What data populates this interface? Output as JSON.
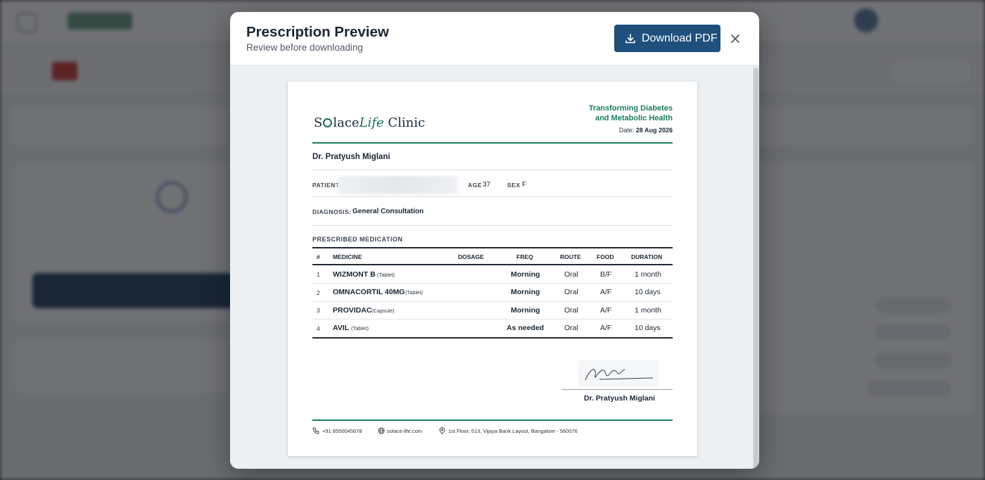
{
  "modal": {
    "title": "Prescription Preview",
    "subtitle": "Review before downloading",
    "download_label": "Download PDF"
  },
  "prescription": {
    "clinic_name": {
      "prefix": "S",
      "mid": "lace",
      "life": "Life",
      "rest": " Clinic"
    },
    "tagline_line1": "Transforming Diabetes",
    "tagline_line2": "and Metabolic Health",
    "date_label": "Date:",
    "date_value": "28 Aug 2026",
    "doctor_name": "Dr. Pratyush Miglani",
    "patient_label": "PATIENT",
    "age_label": "AGE",
    "age_value": "37",
    "sex_label": "SEX",
    "sex_value": "F",
    "diagnosis_label": "DIAGNOSIS:",
    "diagnosis_value": "General Consultation",
    "section_title": "PRESCRIBED MEDICATION",
    "columns": [
      "#",
      "MEDICINE",
      "DOSAGE",
      "FREQ",
      "ROUTE",
      "FOOD",
      "DURATION"
    ],
    "medications": [
      {
        "num": "1",
        "name": "WIZMONT B",
        "form": "(Tablet)",
        "dosage": "",
        "freq": "Morning",
        "route": "Oral",
        "food": "B/F",
        "duration": "1 month"
      },
      {
        "num": "2",
        "name": "OMNACORTIL 40MG",
        "form": "(Tablet)",
        "dosage": "",
        "freq": "Morning",
        "route": "Oral",
        "food": "A/F",
        "duration": "10 days"
      },
      {
        "num": "3",
        "name": "PROVIDAC",
        "form": "(Capsule)",
        "dosage": "",
        "freq": "Morning",
        "route": "Oral",
        "food": "A/F",
        "duration": "1 month"
      },
      {
        "num": "4",
        "name": "AVIL",
        "form": "(Tablet)",
        "dosage": "",
        "freq": "As needed",
        "route": "Oral",
        "food": "A/F",
        "duration": "10 days"
      }
    ],
    "signature_name": "Dr. Pratyush Miglani",
    "footer_phone": "+91 8550045678",
    "footer_web": "solace-life.com",
    "footer_address": "1st Floor, 513, Vijaya Bank Layout, Bangalore - 560076"
  },
  "icons": [
    "download-icon",
    "close-icon",
    "phone-icon",
    "globe-icon",
    "location-pin-icon"
  ],
  "colors": {
    "primary": "#1e4f7d",
    "brand_green": "#1a7d60",
    "overlay": "rgba(24,26,30,0.62)"
  }
}
